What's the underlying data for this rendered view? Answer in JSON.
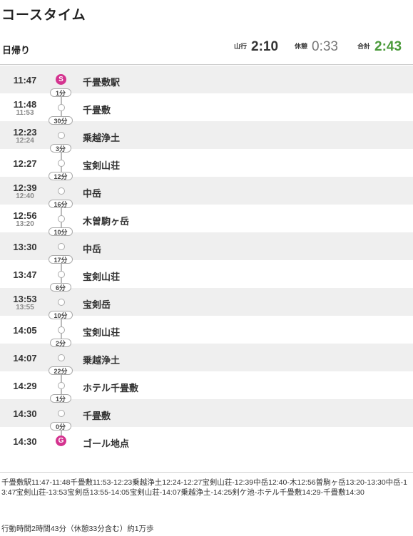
{
  "title": "コースタイム",
  "summary": {
    "trip_type": "日帰り",
    "climb_label": "山行",
    "climb_time": "2:10",
    "rest_label": "休憩",
    "rest_time": "0:33",
    "total_label": "合計",
    "total_time": "2:43"
  },
  "stops": [
    {
      "arrive": "11:47",
      "depart": "",
      "name": "千畳敷駅",
      "marker": "S"
    },
    {
      "arrive": "11:48",
      "depart": "11:53",
      "name": "千畳敷",
      "marker": ""
    },
    {
      "arrive": "12:23",
      "depart": "12:24",
      "name": "乗越浄土",
      "marker": ""
    },
    {
      "arrive": "12:27",
      "depart": "",
      "name": "宝剣山荘",
      "marker": ""
    },
    {
      "arrive": "12:39",
      "depart": "12:40",
      "name": "中岳",
      "marker": ""
    },
    {
      "arrive": "12:56",
      "depart": "13:20",
      "name": "木曽駒ヶ岳",
      "marker": ""
    },
    {
      "arrive": "13:30",
      "depart": "",
      "name": "中岳",
      "marker": ""
    },
    {
      "arrive": "13:47",
      "depart": "",
      "name": "宝剣山荘",
      "marker": ""
    },
    {
      "arrive": "13:53",
      "depart": "13:55",
      "name": "宝剣岳",
      "marker": ""
    },
    {
      "arrive": "14:05",
      "depart": "",
      "name": "宝剣山荘",
      "marker": ""
    },
    {
      "arrive": "14:07",
      "depart": "",
      "name": "乗越浄土",
      "marker": ""
    },
    {
      "arrive": "14:29",
      "depart": "",
      "name": "ホテル千畳敷",
      "marker": ""
    },
    {
      "arrive": "14:30",
      "depart": "",
      "name": "千畳敷",
      "marker": ""
    },
    {
      "arrive": "14:30",
      "depart": "",
      "name": "ゴール地点",
      "marker": "G"
    }
  ],
  "segments": [
    "1分",
    "30分",
    "3分",
    "12分",
    "16分",
    "10分",
    "17分",
    "6分",
    "10分",
    "2分",
    "22分",
    "1分",
    "0分"
  ],
  "route_text": "千畳敷駅11:47-11:48千畳敷11:53-12:23乗越浄土12:24-12:27宝剣山荘-12:39中岳12:40-木12:56曽駒ヶ岳13:20-13:30中岳-13:47宝剣山荘-13:53宝剣岳13:55-14:05宝剣山荘-14:07乗越浄土-14:25剣ケ池-ホテル千畳敷14:29-千畳敷14:30",
  "footer": "行動時間2時間43分（休憩33分含む）約1万歩"
}
